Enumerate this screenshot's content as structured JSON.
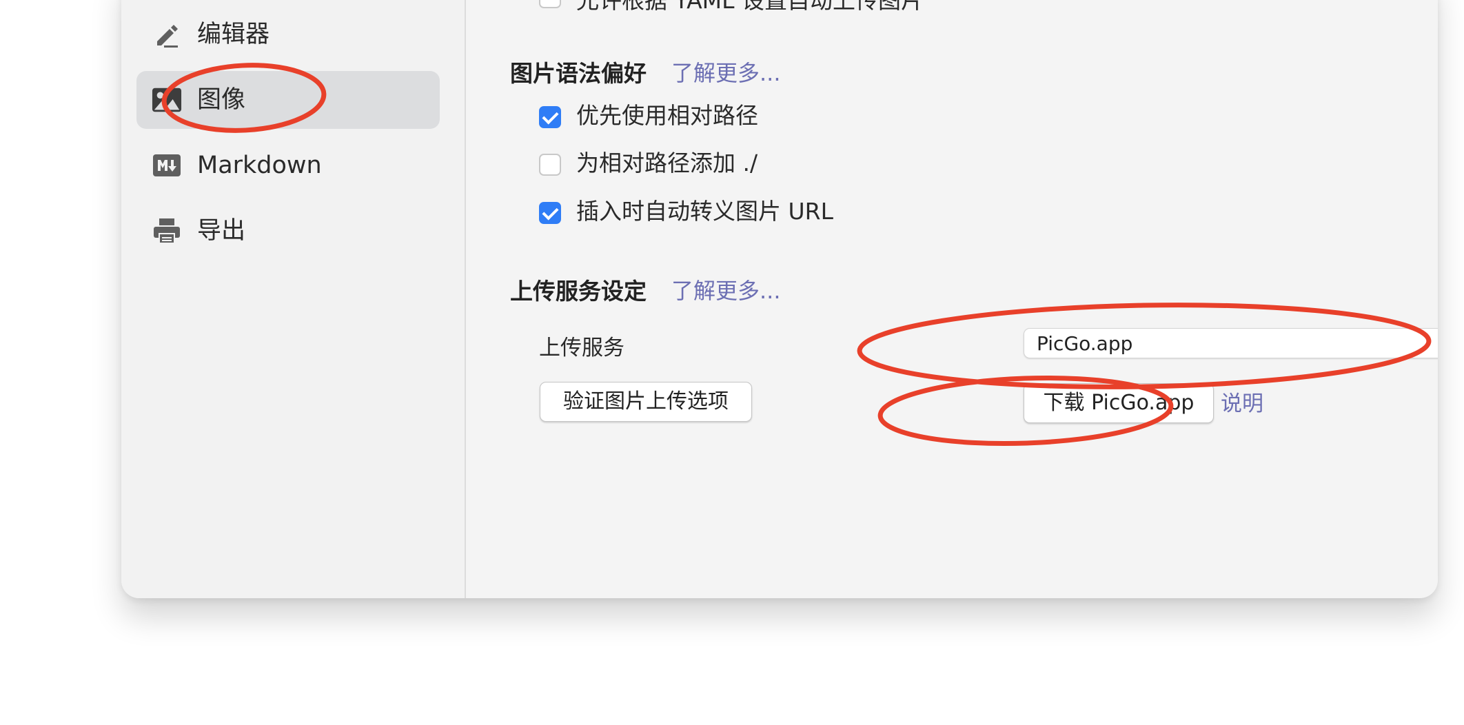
{
  "sidebar": {
    "items": [
      {
        "label": "编辑器",
        "icon": "pen-icon",
        "active": false
      },
      {
        "label": "图像",
        "icon": "image-icon",
        "active": true
      },
      {
        "label": "Markdown",
        "icon": "markdown-icon",
        "active": false
      },
      {
        "label": "导出",
        "icon": "printer-icon",
        "active": false
      }
    ]
  },
  "main": {
    "cut_off_option": {
      "label": "允许根据 YAML 设置自动上传图片",
      "checked": false
    },
    "image_syntax": {
      "title": "图片语法偏好",
      "learn_more": "了解更多...",
      "options": [
        {
          "label": "优先使用相对路径",
          "checked": true,
          "help": false
        },
        {
          "label": "为相对路径添加 ./",
          "checked": false,
          "help": true
        },
        {
          "label": "插入时自动转义图片 URL",
          "checked": true,
          "help": true
        }
      ],
      "help_glyph": "?"
    },
    "upload": {
      "title": "上传服务设定",
      "learn_more": "了解更多...",
      "service_label": "上传服务",
      "service_value": "PicGo.app",
      "verify_button": "验证图片上传选项",
      "download_button": "下载 PicGo.app",
      "explain_link": "说明"
    }
  },
  "colors": {
    "accent": "#2f7df6",
    "link": "#6c6fb3",
    "annotation": "#e8402a"
  }
}
